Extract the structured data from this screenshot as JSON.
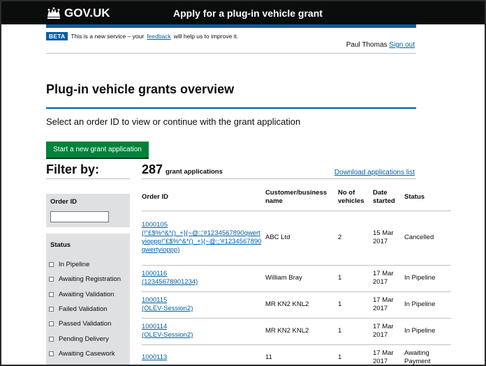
{
  "header": {
    "logo_text": "GOV.UK",
    "service_name": "Apply for a plug-in vehicle grant"
  },
  "phase_banner": {
    "tag": "BETA",
    "text_before": "This is a new service – your",
    "feedback_link": "feedback",
    "text_after": "will help us to improve it."
  },
  "user": {
    "name": "Paul Thomas",
    "sign_out": "Sign out"
  },
  "page": {
    "title": "Plug-in vehicle grants overview",
    "lede": "Select an order ID to view or continue with the grant application",
    "start_button": "Start a new grant application"
  },
  "filter": {
    "title": "Filter by:",
    "order_id_label": "Order ID",
    "order_id_value": "",
    "status_label": "Status",
    "statuses": [
      "In Pipeline",
      "Awaiting Registration",
      "Awaiting Validation",
      "Failed Validation",
      "Passed Validation",
      "Pending Delivery",
      "Awaiting Casework"
    ]
  },
  "results": {
    "count": "287",
    "count_label": "grant applications",
    "download_link": "Download applications list"
  },
  "table": {
    "headers": {
      "order_id": "Order ID",
      "customer": "Customer/business name",
      "vehicles": "No of vehicles",
      "date": "Date started",
      "status": "Status"
    },
    "rows": [
      {
        "order_id": "1000105",
        "order_ref": "(!\"£$%^&*()_+}{~@:;'#1234567890qwertyioppp!\"£$%^&*()_+}{~@:;'#1234567890qwertyioppp)",
        "customer": "ABC Ltd",
        "vehicles": "2",
        "date": "15 Mar 2017",
        "status": "Cancelled"
      },
      {
        "order_id": "1000116",
        "order_ref": "(12345678901234)",
        "customer": "William Bray",
        "vehicles": "1",
        "date": "17 Mar 2017",
        "status": "In Pipeline"
      },
      {
        "order_id": "1000115",
        "order_ref": "(OLEV-Session2)",
        "customer": "MR KN2 KNL2",
        "vehicles": "1",
        "date": "17 Mar 2017",
        "status": "In Pipeline"
      },
      {
        "order_id": "1000114",
        "order_ref": "(OLEV-Session2)",
        "customer": "MR KN2 KNL2",
        "vehicles": "1",
        "date": "17 Mar 2017",
        "status": "In Pipeline"
      },
      {
        "order_id": "1000113",
        "order_ref": "",
        "customer": "11",
        "vehicles": "1",
        "date": "17 Mar 2017",
        "status": "Awaiting Payment"
      }
    ]
  },
  "colors": {
    "header_bg": "#0b0c0c",
    "blue_bar": "#005ea5",
    "link": "#005ea5",
    "button_green": "#00823b",
    "filter_bg": "#dee0e2"
  }
}
